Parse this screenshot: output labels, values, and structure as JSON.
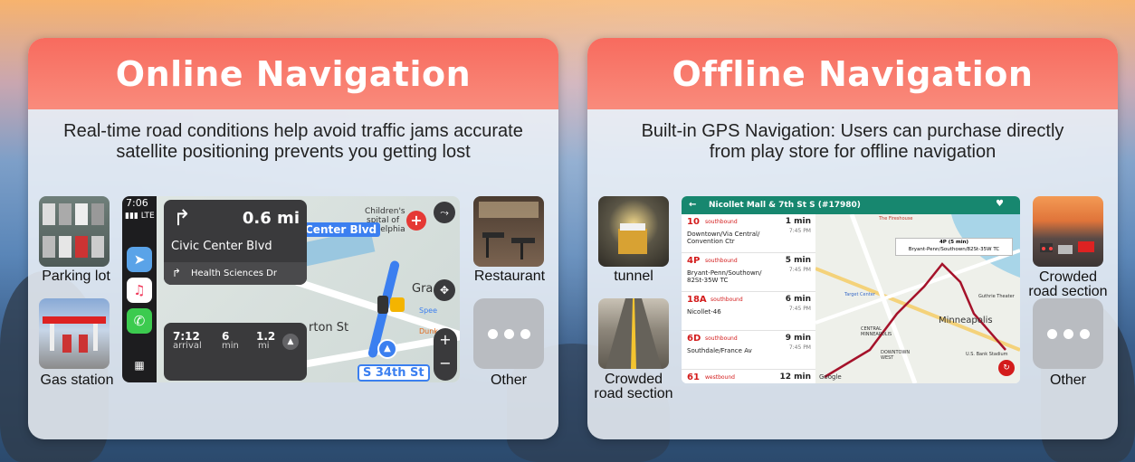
{
  "online": {
    "title": "Online Navigation",
    "description_line1": "Real-time road conditions help avoid traffic jams accurate",
    "description_line2": "satellite positioning prevents you getting lost",
    "thumbs": {
      "parking": "Parking lot",
      "gas": "Gas station",
      "restaurant": "Restaurant",
      "other": "Other"
    },
    "screen": {
      "time": "7:06",
      "signal": "LTE",
      "distance": "0.6 mi",
      "road": "Civic Center Blvd",
      "next_road": "Health Sciences Dr",
      "street_label_1": "Center Blvd",
      "street_label_2": "S 34th St",
      "map_text_1": "Children's",
      "map_text_2": "spital of",
      "map_text_3": "adelphia",
      "map_text_4": "Gra",
      "map_text_5": "rton St",
      "map_text_6": "Dunk",
      "map_text_7": "Spee",
      "eta_arrival_value": "7:12",
      "eta_arrival_unit": "arrival",
      "eta_min_value": "6",
      "eta_min_unit": "min",
      "eta_mi_value": "1.2",
      "eta_mi_unit": "mi"
    }
  },
  "offline": {
    "title": "Offline Navigation",
    "description_line1": "Built-in GPS Navigation: Users can purchase directly",
    "description_line2": "from play store for offline navigation",
    "thumbs": {
      "tunnel": "tunnel",
      "crowded_left_1": "Crowded",
      "crowded_left_2": "road section",
      "crowded_right_1": "Crowded",
      "crowded_right_2": "road section",
      "other": "Other"
    },
    "screen": {
      "header": "Nicollet Mall & 7th St S (#17980)",
      "rows": [
        {
          "route": "10",
          "dir": "southbound",
          "name": "Downtown/Via Central/ Convention Ctr",
          "min": "1 min",
          "time": "7:45 PM"
        },
        {
          "route": "4P",
          "dir": "southbound",
          "name": "Bryant-Penn/Southown/ 82St-35W TC",
          "min": "5 min",
          "time": "7:45 PM"
        },
        {
          "route": "18A",
          "dir": "southbound",
          "name": "Nicollet-46",
          "min": "6 min",
          "time": "7:45 PM"
        },
        {
          "route": "6D",
          "dir": "southbound",
          "name": "Southdale/France Av",
          "min": "9 min",
          "time": "7:45 PM"
        },
        {
          "route": "61",
          "dir": "westbound",
          "name": "",
          "min": "12 min",
          "time": ""
        }
      ],
      "map_popup_1": "4P (5 min)",
      "map_popup_2": "Bryant-Penn/Southown/82St-35W TC",
      "map_city": "Minneapolis",
      "map_text_1": "The Fireshouse",
      "map_text_2": "Target Center",
      "map_text_3": "CENTRAL MINNEAPOLIS",
      "map_text_4": "DOWNTOWN WEST",
      "map_text_5": "U.S. Bank Stadium",
      "map_text_6": "Guthrie Theater",
      "map_text_7": "Google"
    }
  },
  "colors": {
    "header_red": "#f86b5e",
    "transit_green": "#17876f",
    "route_red": "#d31b1b",
    "cp_blue": "#3b7ff0"
  }
}
